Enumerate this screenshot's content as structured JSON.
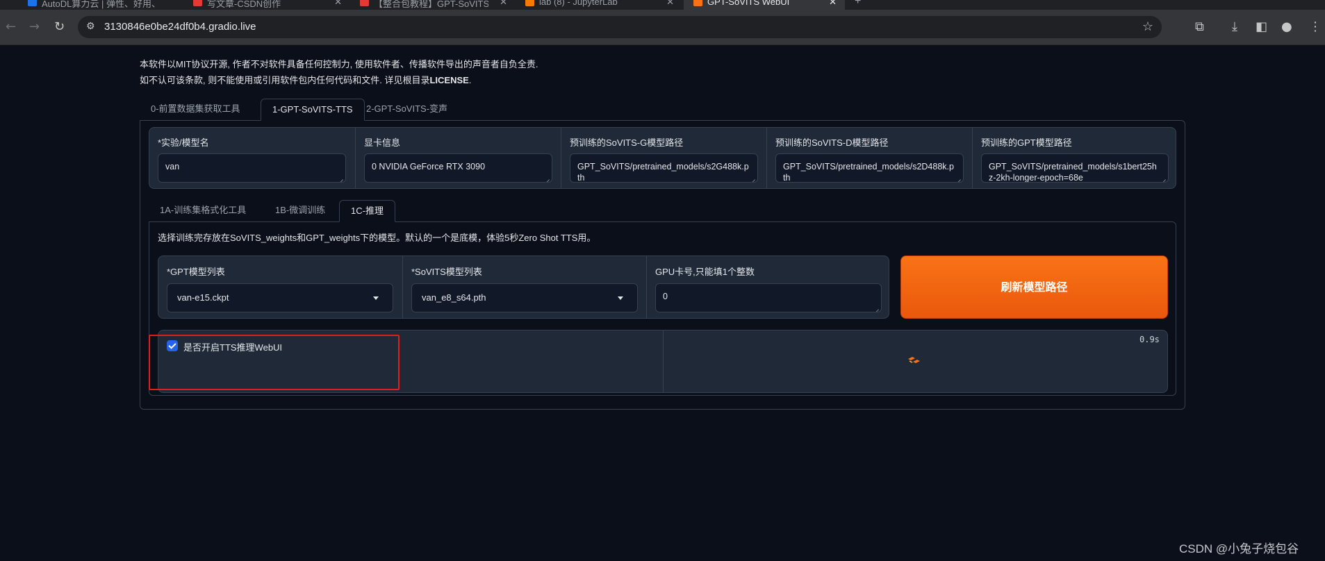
{
  "browser": {
    "tabs": [
      {
        "title": "AutoDL算力云 | 弹性、好用、",
        "favicon_color": "#1a73e8"
      },
      {
        "title": "写文章-CSDN创作",
        "favicon_color": "#e53935"
      },
      {
        "title": "【整合包教程】GPT-SoVITS从",
        "favicon_color": "#e53935"
      },
      {
        "title": "lab (8) - JupyterLab",
        "favicon_color": "#f57c00"
      },
      {
        "title": "GPT-SoVITS WebUI",
        "favicon_color": "#f97316",
        "active": true
      }
    ],
    "url": "3130846e0be24df0b4.gradio.live",
    "icons": [
      "back-icon",
      "forward-icon",
      "reload-icon",
      "site-info-icon",
      "bookmark-star-icon",
      "extensions-icon",
      "download-icon",
      "side-panel-icon",
      "profile-icon",
      "menu-icon"
    ]
  },
  "disclaimer": {
    "line1": "本软件以MIT协议开源, 作者不对软件具备任何控制力, 使用软件者、传播软件导出的声音者自负全责.",
    "line2_prefix": "如不认可该条款, 则不能使用或引用软件包内任何代码和文件. 详见根目录",
    "line2_license": "LICENSE",
    "line2_suffix": "."
  },
  "main_tabs": [
    {
      "label": "0-前置数据集获取工具",
      "selected": false
    },
    {
      "label": "1-GPT-SoVITS-TTS",
      "selected": true
    },
    {
      "label": "2-GPT-SoVITS-变声",
      "selected": false
    }
  ],
  "config_fields": [
    {
      "label": "*实验/模型名",
      "value": "van"
    },
    {
      "label": "显卡信息",
      "value": "0 NVIDIA GeForce RTX 3090"
    },
    {
      "label": "预训练的SoVITS-G模型路径",
      "value": "GPT_SoVITS/pretrained_models/s2G488k.pth"
    },
    {
      "label": "预训练的SoVITS-D模型路径",
      "value": "GPT_SoVITS/pretrained_models/s2D488k.pth"
    },
    {
      "label": "预训练的GPT模型路径",
      "value": "GPT_SoVITS/pretrained_models/s1bert25hz-2kh-longer-epoch=68e"
    }
  ],
  "sub_tabs": [
    {
      "label": "1A-训练集格式化工具",
      "selected": false
    },
    {
      "label": "1B-微调训练",
      "selected": false
    },
    {
      "label": "1C-推理",
      "selected": true
    }
  ],
  "inference": {
    "description": "选择训练完存放在SoVITS_weights和GPT_weights下的模型。默认的一个是底模，体验5秒Zero Shot TTS用。",
    "gpt_model": {
      "label": "*GPT模型列表",
      "value": "van-e15.ckpt"
    },
    "sovits_model": {
      "label": "*SoVITS模型列表",
      "value": "van_e8_s64.pth"
    },
    "gpu": {
      "label": "GPU卡号,只能填1个整数",
      "value": "0"
    },
    "refresh_button": "刷新模型路径",
    "tts_checkbox": {
      "label": "是否开启TTS推理WebUI",
      "checked": true
    },
    "timer": "0.9s"
  },
  "watermark": "CSDN @小兔子烧包谷",
  "colors": {
    "accent": "#f97316",
    "background": "#0b0f19",
    "panel": "#1f2937",
    "highlight": "#e11d1d"
  }
}
